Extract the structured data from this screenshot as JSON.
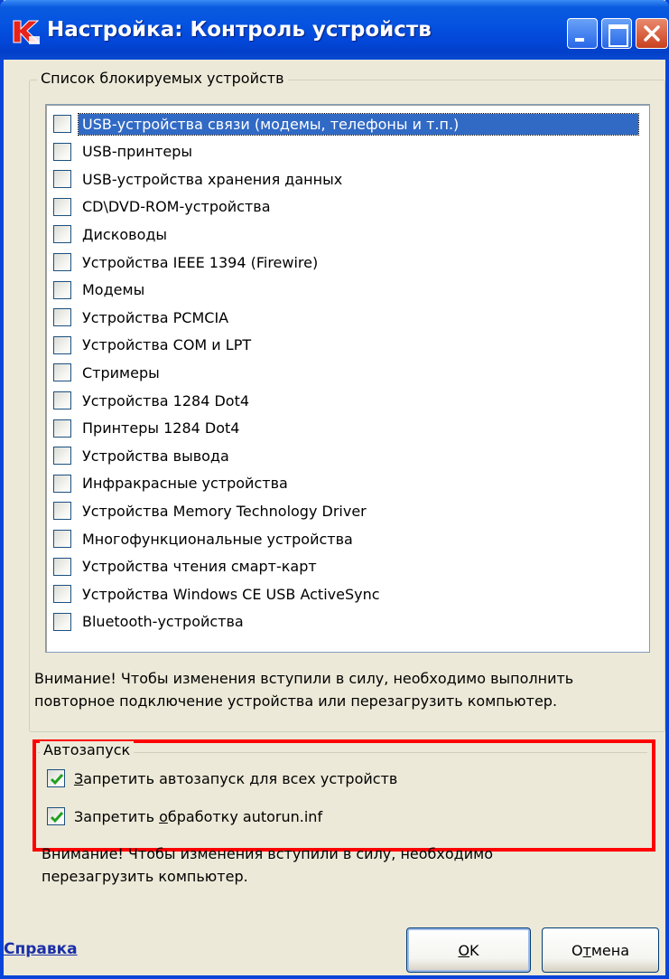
{
  "window": {
    "title": "Настройка: Контроль устройств",
    "title_bar_color": "#0553e0",
    "app_icon": "kaspersky-k-icon"
  },
  "devices_group": {
    "legend": "Список блокируемых устройств",
    "items": [
      {
        "label": "USB-устройства связи (модемы, телефоны и т.п.)",
        "checked": false,
        "selected": true
      },
      {
        "label": "USB-принтеры",
        "checked": false
      },
      {
        "label": "USB-устройства хранения данных",
        "checked": false
      },
      {
        "label": "CD\\DVD-ROM-устройства",
        "checked": false
      },
      {
        "label": "Дисководы",
        "checked": false
      },
      {
        "label": "Устройства IEEE 1394 (Firewire)",
        "checked": false
      },
      {
        "label": "Модемы",
        "checked": false
      },
      {
        "label": "Устройства PCMCIA",
        "checked": false
      },
      {
        "label": "Устройства COM и LPT",
        "checked": false
      },
      {
        "label": "Стримеры",
        "checked": false
      },
      {
        "label": "Устройства 1284 Dot4",
        "checked": false
      },
      {
        "label": "Принтеры 1284 Dot4",
        "checked": false
      },
      {
        "label": "Устройства вывода",
        "checked": false
      },
      {
        "label": "Инфракрасные устройства",
        "checked": false
      },
      {
        "label": "Устройства Memory Technology Driver",
        "checked": false
      },
      {
        "label": "Многофункциональные устройства",
        "checked": false
      },
      {
        "label": "Устройства чтения смарт-карт",
        "checked": false
      },
      {
        "label": "Устройства Windows CE USB ActiveSync",
        "checked": false
      },
      {
        "label": "Bluetooth-устройства",
        "checked": false
      }
    ],
    "notice_line1": "Внимание! Чтобы изменения вступили в силу, необходимо выполнить",
    "notice_line2": "повторное подключение устройства или перезагрузить компьютер."
  },
  "autorun_group": {
    "legend": "Автозапуск",
    "highlight_color": "#ff0000",
    "options": [
      {
        "label_mnemonic": "З",
        "label_rest": "апретить автозапуск для всех устройств",
        "checked": true
      },
      {
        "label_prefix": "Запретить ",
        "label_mnemonic": "о",
        "label_rest": "бработку autorun.inf",
        "checked": true
      }
    ],
    "notice_line1": "Внимание! Чтобы изменения вступили в силу, необходимо",
    "notice_line2": "перезагрузить компьютер."
  },
  "footer": {
    "help_link": "Справка",
    "ok_mnemonic": "О",
    "ok_rest": "K",
    "cancel_prefix": "О",
    "cancel_mnemonic": "т",
    "cancel_rest": "мена"
  }
}
